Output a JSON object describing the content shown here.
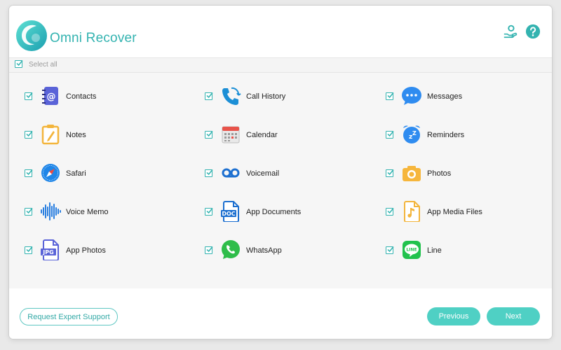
{
  "app": {
    "title": "Omni Recover"
  },
  "header": {
    "support_icon": "support-icon",
    "help_icon": "help-icon"
  },
  "select_all": {
    "label": "Select all",
    "checked": true
  },
  "items": [
    {
      "label": "Contacts",
      "icon": "contacts-icon",
      "checked": true
    },
    {
      "label": "Call History",
      "icon": "call-history-icon",
      "checked": true
    },
    {
      "label": "Messages",
      "icon": "messages-icon",
      "checked": true
    },
    {
      "label": "Notes",
      "icon": "notes-icon",
      "checked": true
    },
    {
      "label": "Calendar",
      "icon": "calendar-icon",
      "checked": true
    },
    {
      "label": "Reminders",
      "icon": "reminders-icon",
      "checked": true
    },
    {
      "label": "Safari",
      "icon": "safari-icon",
      "checked": true
    },
    {
      "label": "Voicemail",
      "icon": "voicemail-icon",
      "checked": true
    },
    {
      "label": "Photos",
      "icon": "photos-icon",
      "checked": true
    },
    {
      "label": "Voice Memo",
      "icon": "voice-memo-icon",
      "checked": true
    },
    {
      "label": "App Documents",
      "icon": "app-documents-icon",
      "checked": true
    },
    {
      "label": "App Media Files",
      "icon": "app-media-files-icon",
      "checked": true
    },
    {
      "label": "App Photos",
      "icon": "app-photos-icon",
      "checked": true
    },
    {
      "label": "WhatsApp",
      "icon": "whatsapp-icon",
      "checked": true
    },
    {
      "label": "Line",
      "icon": "line-icon",
      "checked": true
    }
  ],
  "icon_text": {
    "app_photos": "JPG",
    "app_documents": "DOC",
    "line": "LINE"
  },
  "footer": {
    "support_button": "Request Expert Support",
    "previous_button": "Previous",
    "next_button": "Next"
  },
  "colors": {
    "accent": "#33b3b0",
    "button": "#4fd0c4",
    "messages": "#2f8cf0",
    "whatsapp": "#2fbd4a",
    "line": "#21c24d"
  }
}
